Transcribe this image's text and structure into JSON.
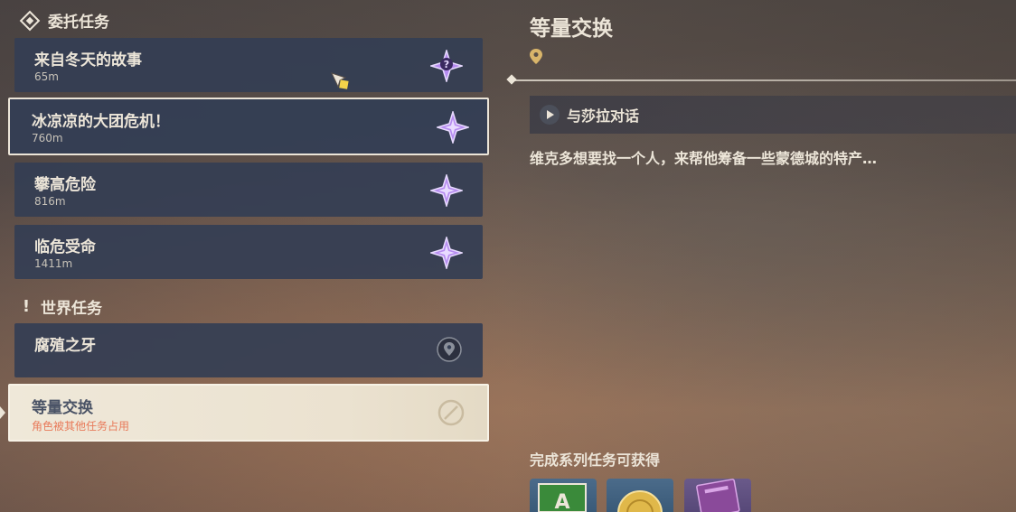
{
  "commissions": {
    "header": "委托任务",
    "header_icon": "commission-diamond-icon",
    "items": [
      {
        "name": "来自冬天的故事",
        "distance": "65m",
        "icon": "purple-question-star-icon"
      },
      {
        "name": "冰凉凉的大团危机！",
        "distance": "760m",
        "icon": "purple-star-icon"
      },
      {
        "name": "攀高危险",
        "distance": "816m",
        "icon": "purple-star-icon"
      },
      {
        "name": "临危受命",
        "distance": "1411m",
        "icon": "purple-star-icon"
      }
    ]
  },
  "world_quests": {
    "header": "世界任务",
    "header_icon": "exclamation-icon",
    "items": [
      {
        "name": "腐殖之牙",
        "status": "",
        "icon": "location-pin-icon"
      },
      {
        "name": "等量交换",
        "status": "角色被其他任务占用",
        "icon": "blocked-icon"
      }
    ]
  },
  "detail": {
    "title": "等量交换",
    "objective": "与莎拉对话",
    "description": "维克多想要找一个人，来帮他筹备一些蒙德城的特产…",
    "rewards_title": "完成系列任务可获得",
    "rewards": [
      "adventure-exp-icon",
      "mora-coin-icon",
      "purple-book-icon"
    ]
  },
  "colors": {
    "panel_bg": "#343e54",
    "text_light": "#ece5d8",
    "star_purple": "#b68cf0",
    "warning": "#e87a5a"
  }
}
